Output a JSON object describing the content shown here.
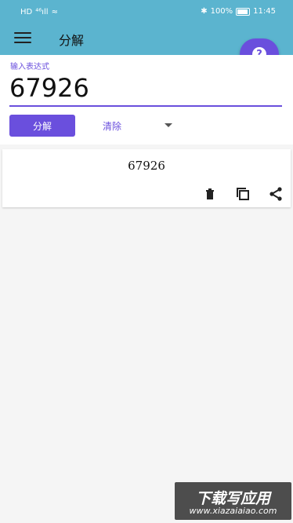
{
  "status_bar": {
    "network": "HD",
    "signal": "⁴⁶ıll",
    "wifi": "≈",
    "bluetooth": "✱",
    "battery_percent": "100%",
    "time": "11:45"
  },
  "app_bar": {
    "title": "分解",
    "menu_icon": "hamburger-menu-icon",
    "help_icon": "question-mark-icon",
    "help_symbol": "?"
  },
  "input": {
    "label": "输入表达式",
    "value": "67926"
  },
  "buttons": {
    "factor": "分解",
    "clear": "清除"
  },
  "result": {
    "text": "67926",
    "icons": [
      "trash-icon",
      "copy-icon",
      "share-icon"
    ]
  },
  "watermark": {
    "line1": "下载写应用",
    "line2": "www.xiazaiaiao.com"
  },
  "colors": {
    "app_bar": "#5bb4cf",
    "accent": "#6a4fdd",
    "background": "#f5f5f5"
  }
}
